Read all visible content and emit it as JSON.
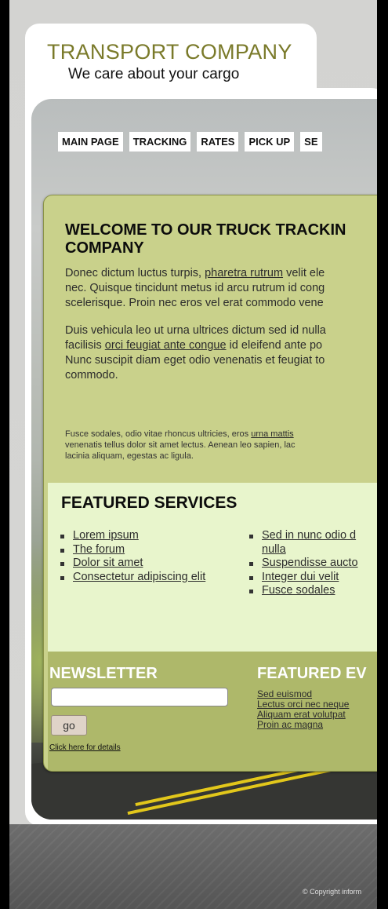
{
  "brand": {
    "title": "TRANSPORT COMPANY",
    "tagline": "We care about your cargo"
  },
  "nav": {
    "items": [
      "MAIN PAGE",
      "TRACKING",
      "RATES",
      "PICK UP",
      "SE"
    ]
  },
  "welcome": {
    "title_line1": "WELCOME TO OUR TRUCK TRACKIN",
    "title_line2": "COMPANY",
    "p1": {
      "l1_a": "Donec dictum luctus turpis, ",
      "l1_link": "pharetra rutrum",
      "l1_b": " velit ele",
      "l2": "nec. Quisque tincidunt metus id arcu rutrum id cong",
      "l3": "scelerisque. Proin nec eros vel erat commodo vene"
    },
    "p2": {
      "l1": "Duis vehicula leo ut urna ultrices dictum sed id nulla",
      "l2_a": "facilisis ",
      "l2_link": "orci feugiat ante congue",
      "l2_b": " id eleifend ante po",
      "l3": "Nunc suscipit diam eget odio venenatis et feugiat to",
      "l4": "commodo."
    },
    "p3": {
      "l1_a": "Fusce sodales, odio vitae rhoncus ultricies, eros ",
      "l1_link": "urna mattis",
      "l2": "venenatis tellus dolor sit amet lectus. Aenean leo sapien, lac",
      "l3": "lacinia aliquam, egestas ac ligula."
    }
  },
  "services": {
    "title": "FEATURED SERVICES",
    "col1": [
      "Lorem ipsum",
      "The forum",
      "Dolor sit amet",
      "Consectetur adipiscing elit"
    ],
    "col2": [
      "Sed in nunc odio d",
      "nulla",
      "Suspendisse aucto",
      "Integer dui velit",
      "Fusce sodales"
    ]
  },
  "newsletter": {
    "title": "NEWSLETTER",
    "input_value": "",
    "button": "go",
    "details": "Click here for details"
  },
  "events": {
    "title": "FEATURED EV",
    "items": [
      "Sed euismod",
      "Lectus orci nec neque",
      "Aliquam erat volutpat",
      "Proin ac magna"
    ]
  },
  "footer": {
    "copyright": "© Copyright inform"
  },
  "colors": {
    "content_bg": "#c9d18b",
    "services_bg": "#e8f5cc",
    "newsletter_bg": "#aeb86a",
    "brand_olive": "#7a7a2a"
  }
}
